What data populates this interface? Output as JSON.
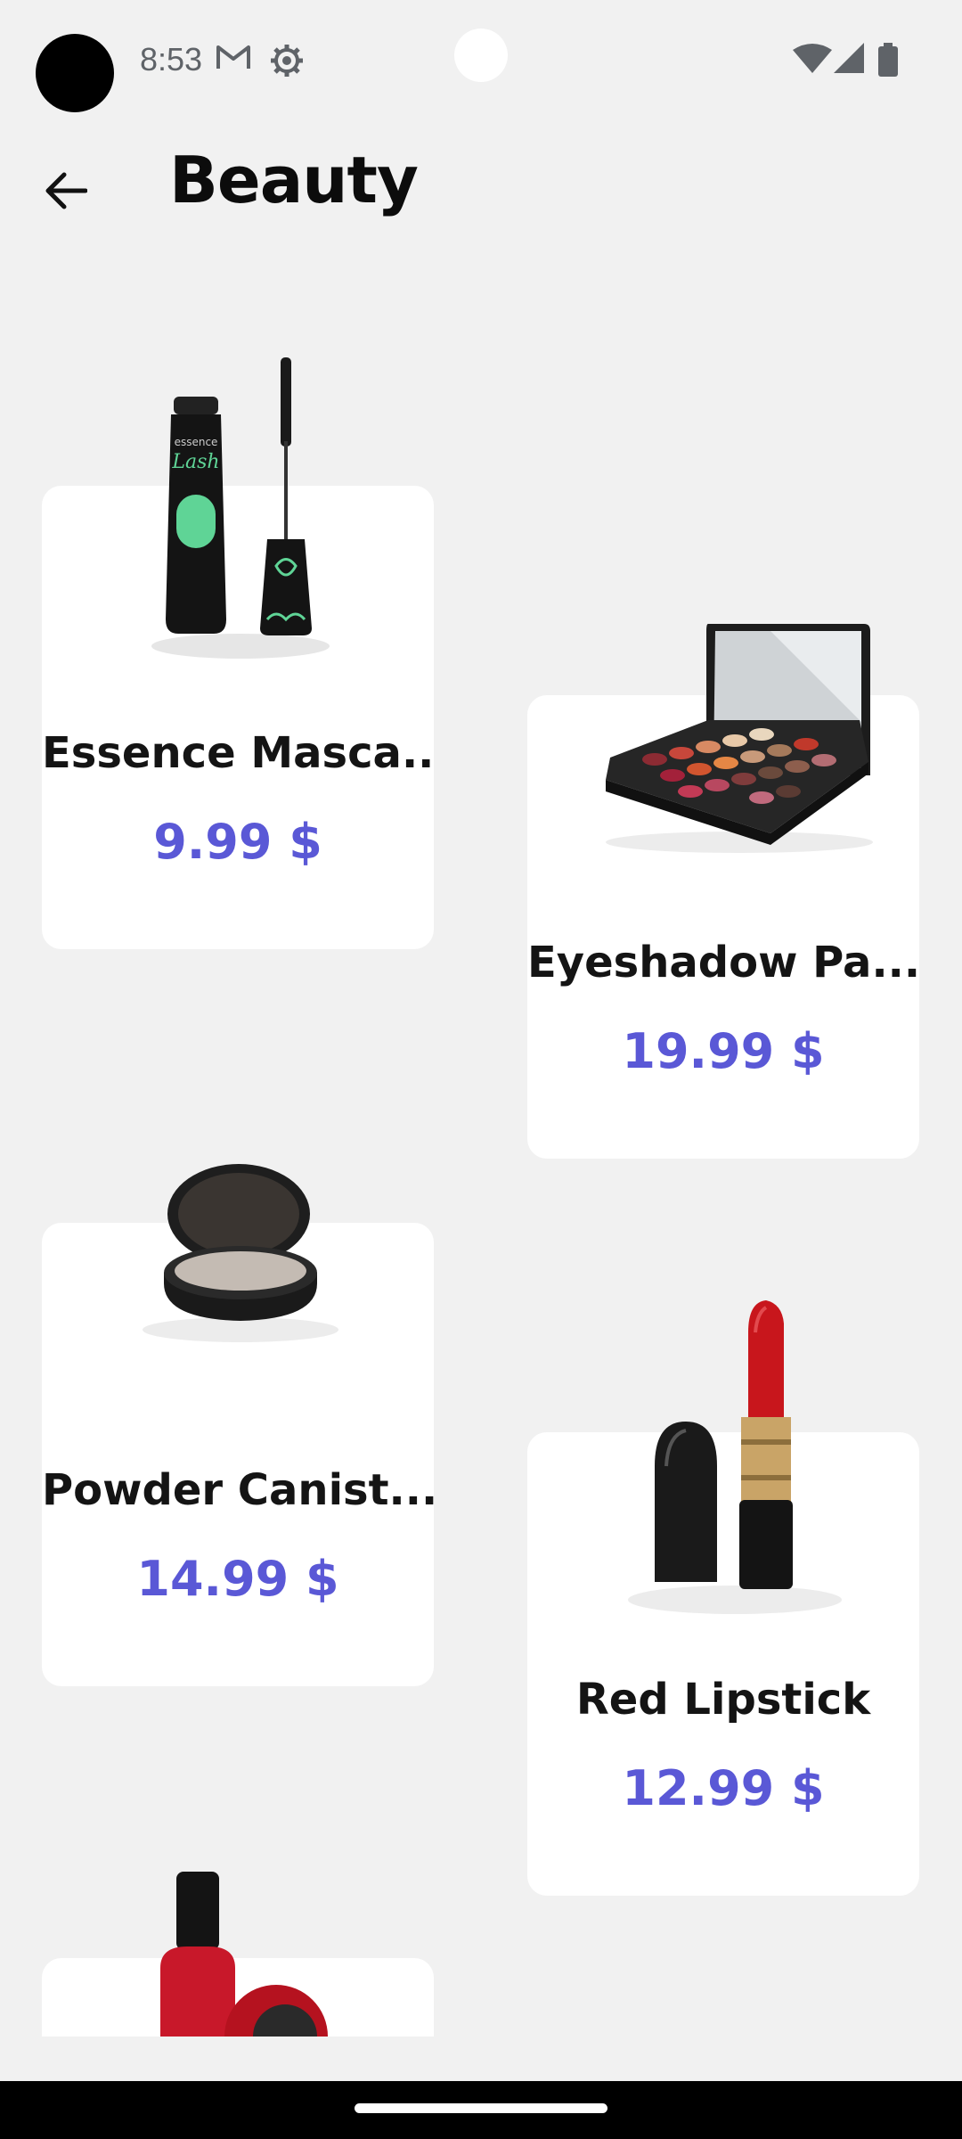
{
  "status_bar": {
    "time": "8:53",
    "icons": [
      "gmail-icon",
      "settings-gear-icon",
      "wifi-icon",
      "cellular-signal-icon",
      "battery-icon"
    ]
  },
  "header": {
    "title": "Beauty",
    "back_icon": "arrow-back-icon"
  },
  "products": [
    {
      "name": "Essence Masca...",
      "price": "9.99 $",
      "image": "mascara"
    },
    {
      "name": "Eyeshadow Pa...",
      "price": "19.99 $",
      "image": "eyeshadow-palette"
    },
    {
      "name": "Powder Canist...",
      "price": "14.99 $",
      "image": "powder-compact"
    },
    {
      "name": "Red Lipstick",
      "price": "12.99 $",
      "image": "red-lipstick"
    },
    {
      "name": "",
      "price": "",
      "image": "nail-polish"
    }
  ],
  "colors": {
    "background": "#f1f1f1",
    "card": "#ffffff",
    "price_accent": "#5a58d6",
    "text": "#141414"
  }
}
